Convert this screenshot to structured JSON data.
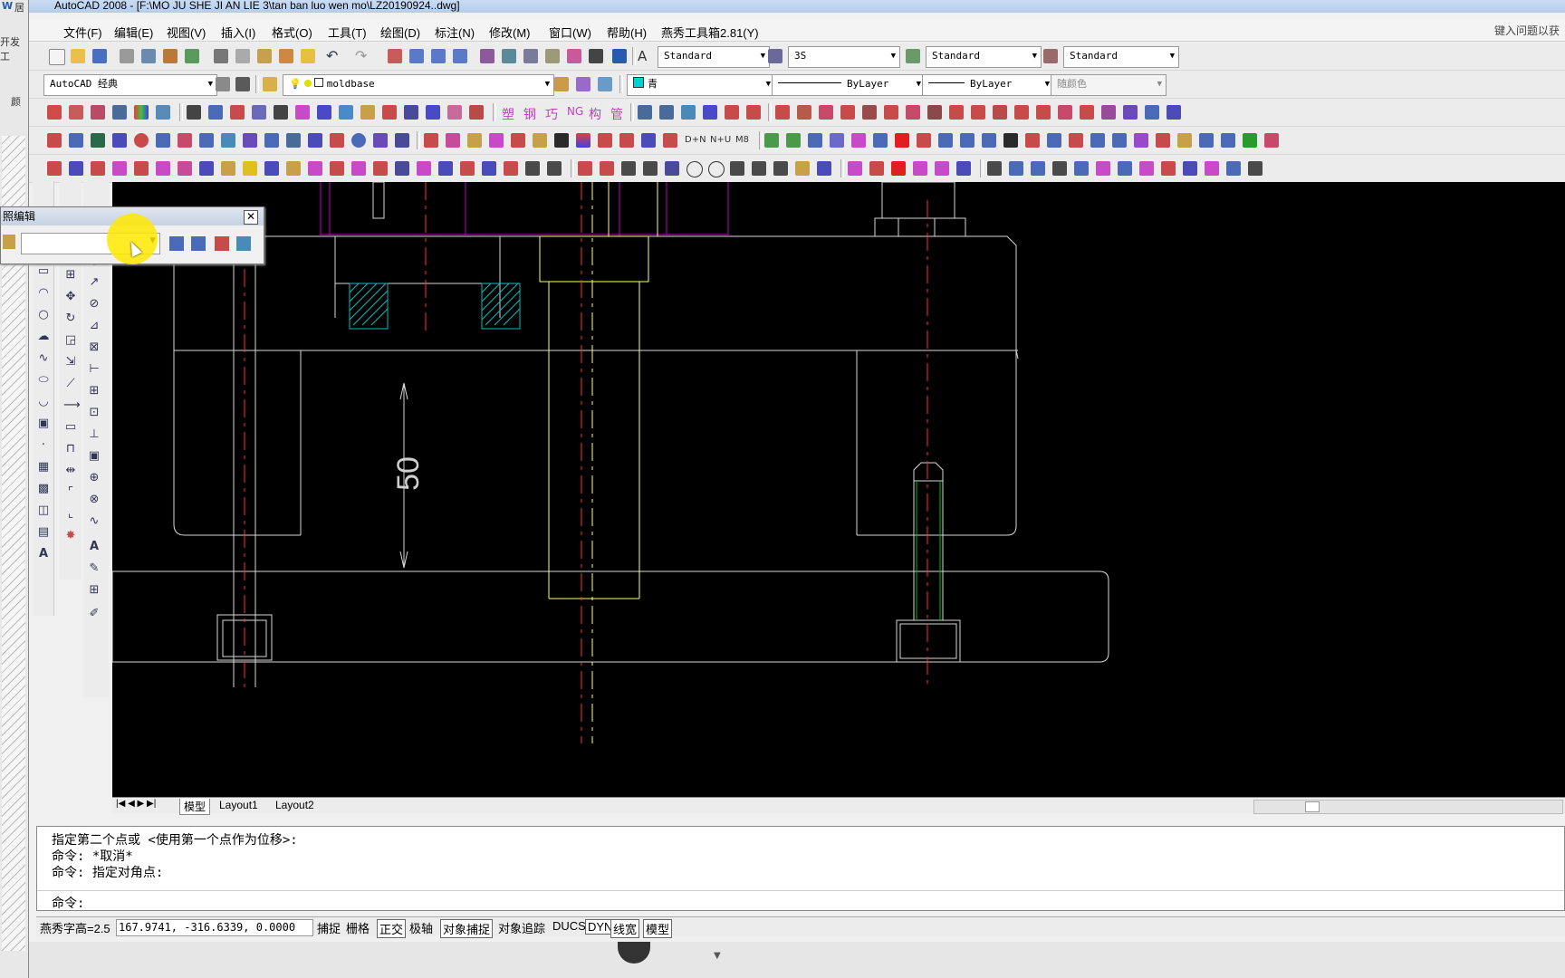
{
  "window": {
    "title": "AutoCAD 2008 - [F:\\MO JU SHE JI AN LIE 3\\tan ban luo wen mo\\LZ20190924..dwg]"
  },
  "host": {
    "glyph_top": "W",
    "glyph_tab": "居",
    "glyph_dev": "开发工",
    "glyph_color": "颜"
  },
  "menu": {
    "items": [
      "文件(F)",
      "编辑(E)",
      "视图(V)",
      "插入(I)",
      "格式(O)",
      "工具(T)",
      "绘图(D)",
      "标注(N)",
      "修改(M)",
      "窗口(W)",
      "帮助(H)",
      "燕秀工具箱2.81(Y)"
    ],
    "help_placeholder": "键入问题以获"
  },
  "toolbar": {
    "text_style": "Standard",
    "dim_style": "3S",
    "table_style": "Standard",
    "multileader_style": "Standard",
    "workspace": "AutoCAD 经典",
    "layer": "moldbase",
    "color": "青",
    "linetype": "ByLayer",
    "lineweight": "ByLayer",
    "plotstyle": "随颜色",
    "chinese_tools": [
      "塑",
      "钢",
      "巧",
      "NG",
      "构",
      "管"
    ],
    "misc_labels": [
      "D+N",
      "N+U",
      "M8"
    ]
  },
  "refedit": {
    "title": "照编辑",
    "field_value": ""
  },
  "drawing": {
    "dimension_text": "50"
  },
  "layout_tabs": [
    "模型",
    "Layout1",
    "Layout2"
  ],
  "command": {
    "lines": [
      "指定第二个点或 <使用第一个点作为位移>:",
      "命令: *取消*",
      "命令: 指定对角点:"
    ],
    "prompt": "命令:"
  },
  "status": {
    "text_height": "燕秀字高=2.5",
    "coordinates": "167.9741, -316.6339, 0.0000",
    "toggles": [
      "捕捉",
      "栅格",
      "正交",
      "极轴",
      "对象捕捉",
      "对象追踪",
      "DUCS",
      "DYN",
      "线宽",
      "模型"
    ],
    "toggles_on": [
      "正交",
      "对象捕捉",
      "DYN",
      "线宽",
      "模型"
    ]
  },
  "colors": {
    "canvas": "#000000",
    "geometry_white": "#d8d8d8",
    "geometry_yellow": "#ffff66",
    "centerline_red": "#ff3030",
    "hatch_cyan": "#00c0c0",
    "magenta": "#c000c0",
    "green": "#00c000"
  }
}
